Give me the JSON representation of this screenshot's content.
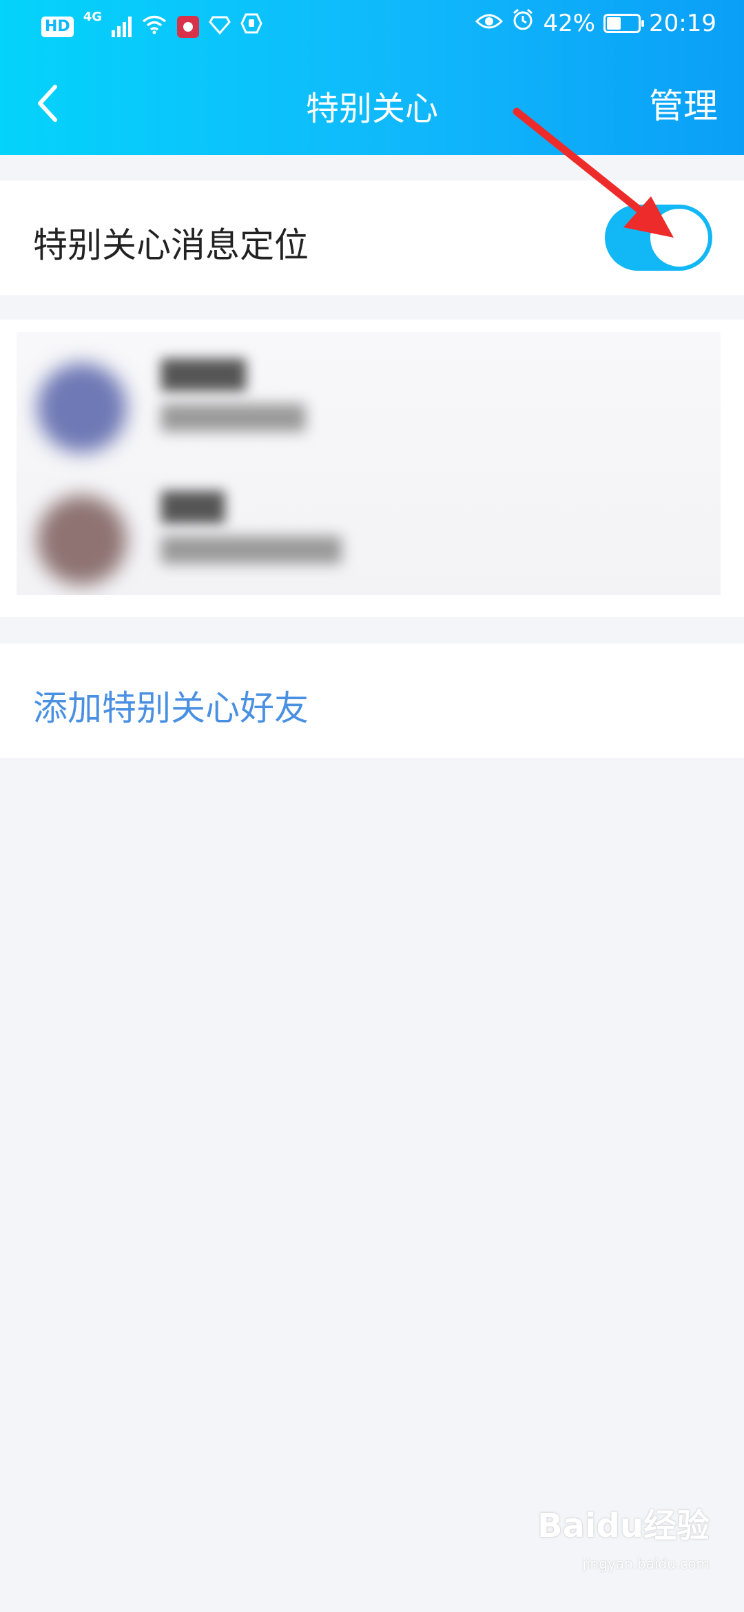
{
  "status_bar": {
    "left_badge": "HD",
    "network": "4G",
    "battery_percent": "42%",
    "time": "20:19"
  },
  "header": {
    "title": "特别关心",
    "action_label": "管理"
  },
  "toggle_row": {
    "label": "特别关心消息定位",
    "state": "on"
  },
  "friends": {
    "items": [
      {
        "avatar_color": "#6f79b5"
      },
      {
        "avatar_color": "#8e7372"
      }
    ]
  },
  "add_friend": {
    "label": "添加特别关心好友"
  },
  "annotation": {
    "arrow_color": "#ee2b2b"
  },
  "watermark": {
    "brand": "Baidu经验",
    "url": "jingyan.baidu.com"
  },
  "colors": {
    "accent": "#12b7f5",
    "link": "#4a90e2",
    "background": "#f4f5f9"
  }
}
